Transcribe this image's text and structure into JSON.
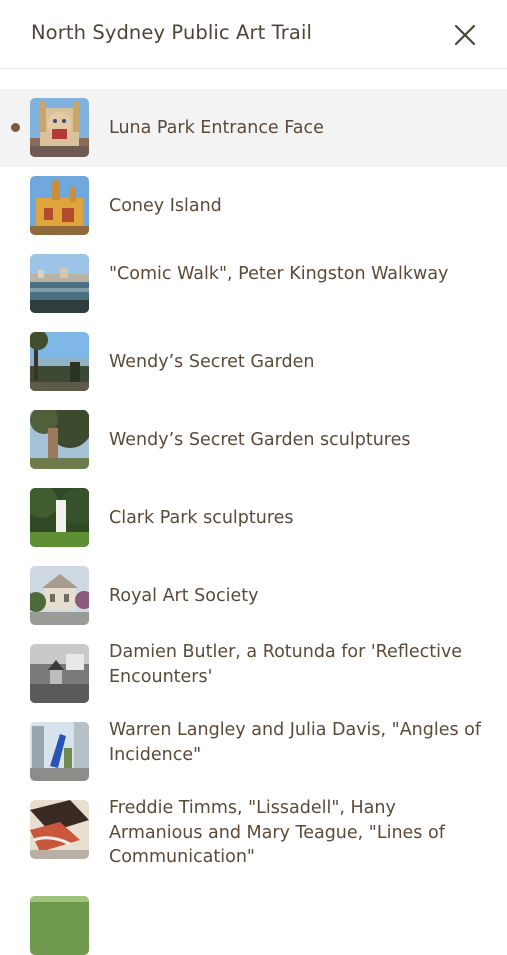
{
  "header": {
    "title": "North Sydney Public Art Trail",
    "close_icon": "close-icon"
  },
  "colors": {
    "text": "#5b4a38",
    "active_bg": "#f3f3f3",
    "active_dot": "#7a5a3a"
  },
  "items": [
    {
      "label": "Luna Park Entrance Face",
      "active": true,
      "thumb": "luna-park-face-photo"
    },
    {
      "label": "Coney Island",
      "active": false,
      "thumb": "coney-island-photo"
    },
    {
      "label": "\"Comic Walk\", Peter Kingston Walkway",
      "active": false,
      "thumb": "harbour-walkway-photo"
    },
    {
      "label": "Wendy’s Secret Garden",
      "active": false,
      "thumb": "secret-garden-photo"
    },
    {
      "label": "Wendy’s Secret Garden sculptures",
      "active": false,
      "thumb": "garden-sculpture-photo"
    },
    {
      "label": "Clark Park sculptures",
      "active": false,
      "thumb": "clark-park-photo"
    },
    {
      "label": "Royal Art Society",
      "active": false,
      "thumb": "royal-art-society-photo"
    },
    {
      "label": "Damien Butler, a Rotunda for 'Reflective Encounters'",
      "active": false,
      "thumb": "rotunda-photo"
    },
    {
      "label": "Warren Langley and Julia Davis, \"Angles of Incidence\"",
      "active": false,
      "thumb": "angles-of-incidence-photo"
    },
    {
      "label": "Freddie Timms, \"Lissadell\", Hany Armanious and Mary Teague, \"Lines of Communication\"",
      "active": false,
      "thumb": "lines-of-communication-photo"
    },
    {
      "label": "",
      "active": false,
      "thumb": "next-item-photo"
    }
  ]
}
